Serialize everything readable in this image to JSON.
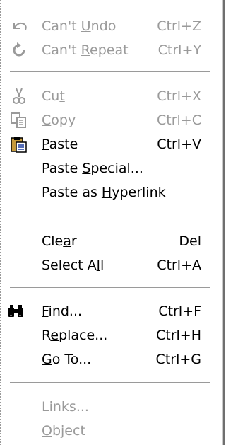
{
  "menu": {
    "items": [
      {
        "label_pre": "Can't ",
        "label_ul": "U",
        "label_post": "ndo",
        "shortcut": "Ctrl+Z",
        "icon": "undo-icon",
        "enabled": false
      },
      {
        "label_pre": "Can't ",
        "label_ul": "R",
        "label_post": "epeat",
        "shortcut": "Ctrl+Y",
        "icon": "repeat-icon",
        "enabled": false
      },
      {
        "label_pre": "Cu",
        "label_ul": "t",
        "label_post": "",
        "shortcut": "Ctrl+X",
        "icon": "cut-icon",
        "enabled": false
      },
      {
        "label_pre": "",
        "label_ul": "C",
        "label_post": "opy",
        "shortcut": "Ctrl+C",
        "icon": "copy-icon",
        "enabled": false
      },
      {
        "label_pre": "",
        "label_ul": "P",
        "label_post": "aste",
        "shortcut": "Ctrl+V",
        "icon": "paste-icon",
        "enabled": true
      },
      {
        "label_pre": "Paste ",
        "label_ul": "S",
        "label_post": "pecial...",
        "shortcut": "",
        "icon": "",
        "enabled": true
      },
      {
        "label_pre": "Paste as ",
        "label_ul": "H",
        "label_post": "yperlink",
        "shortcut": "",
        "icon": "",
        "enabled": true
      },
      {
        "label_pre": "Cle",
        "label_ul": "a",
        "label_post": "r",
        "shortcut": "Del",
        "icon": "",
        "enabled": true
      },
      {
        "label_pre": "Select A",
        "label_ul": "l",
        "label_post": "l",
        "shortcut": "Ctrl+A",
        "icon": "",
        "enabled": true
      },
      {
        "label_pre": "",
        "label_ul": "F",
        "label_post": "ind...",
        "shortcut": "Ctrl+F",
        "icon": "binoculars-icon",
        "enabled": true
      },
      {
        "label_pre": "R",
        "label_ul": "e",
        "label_post": "place...",
        "shortcut": "Ctrl+H",
        "icon": "",
        "enabled": true
      },
      {
        "label_pre": "",
        "label_ul": "G",
        "label_post": "o To...",
        "shortcut": "Ctrl+G",
        "icon": "",
        "enabled": true
      },
      {
        "label_pre": "Lin",
        "label_ul": "k",
        "label_post": "s...",
        "shortcut": "",
        "icon": "",
        "enabled": false
      },
      {
        "label_pre": "",
        "label_ul": "O",
        "label_post": "bject",
        "shortcut": "",
        "icon": "",
        "enabled": false
      }
    ]
  },
  "colors": {
    "disabled_text": "#9a9a9a",
    "enabled_text": "#000000",
    "background": "#ffffff"
  }
}
